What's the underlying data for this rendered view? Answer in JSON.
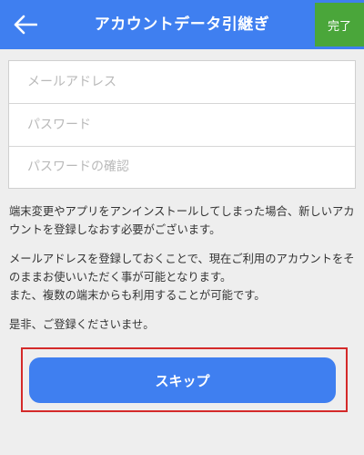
{
  "header": {
    "back_icon": "arrow-left-icon",
    "title": "アカウントデータ引継ぎ",
    "done_label": "完了",
    "bg_color": "#3f7ff0",
    "done_color": "#4aa63a"
  },
  "form": {
    "email_placeholder": "メールアドレス",
    "password_placeholder": "パスワード",
    "password_confirm_placeholder": "パスワードの確認"
  },
  "description": {
    "para1": "端末変更やアプリをアンインストールしてしまった場合、新しいアカウントを登録しなおす必要がございます。",
    "para2_line1": "メールアドレスを登録しておくことで、現在ご利用のアカウントをそのままお使いいただく事が可能となります。",
    "para2_line2": "また、複数の端末からも利用することが可能です。",
    "para3": "是非、ご登録くださいませ。"
  },
  "skip_button": {
    "label": "スキップ",
    "color": "#3f7ff0",
    "highlight_color": "#d42a2a"
  }
}
